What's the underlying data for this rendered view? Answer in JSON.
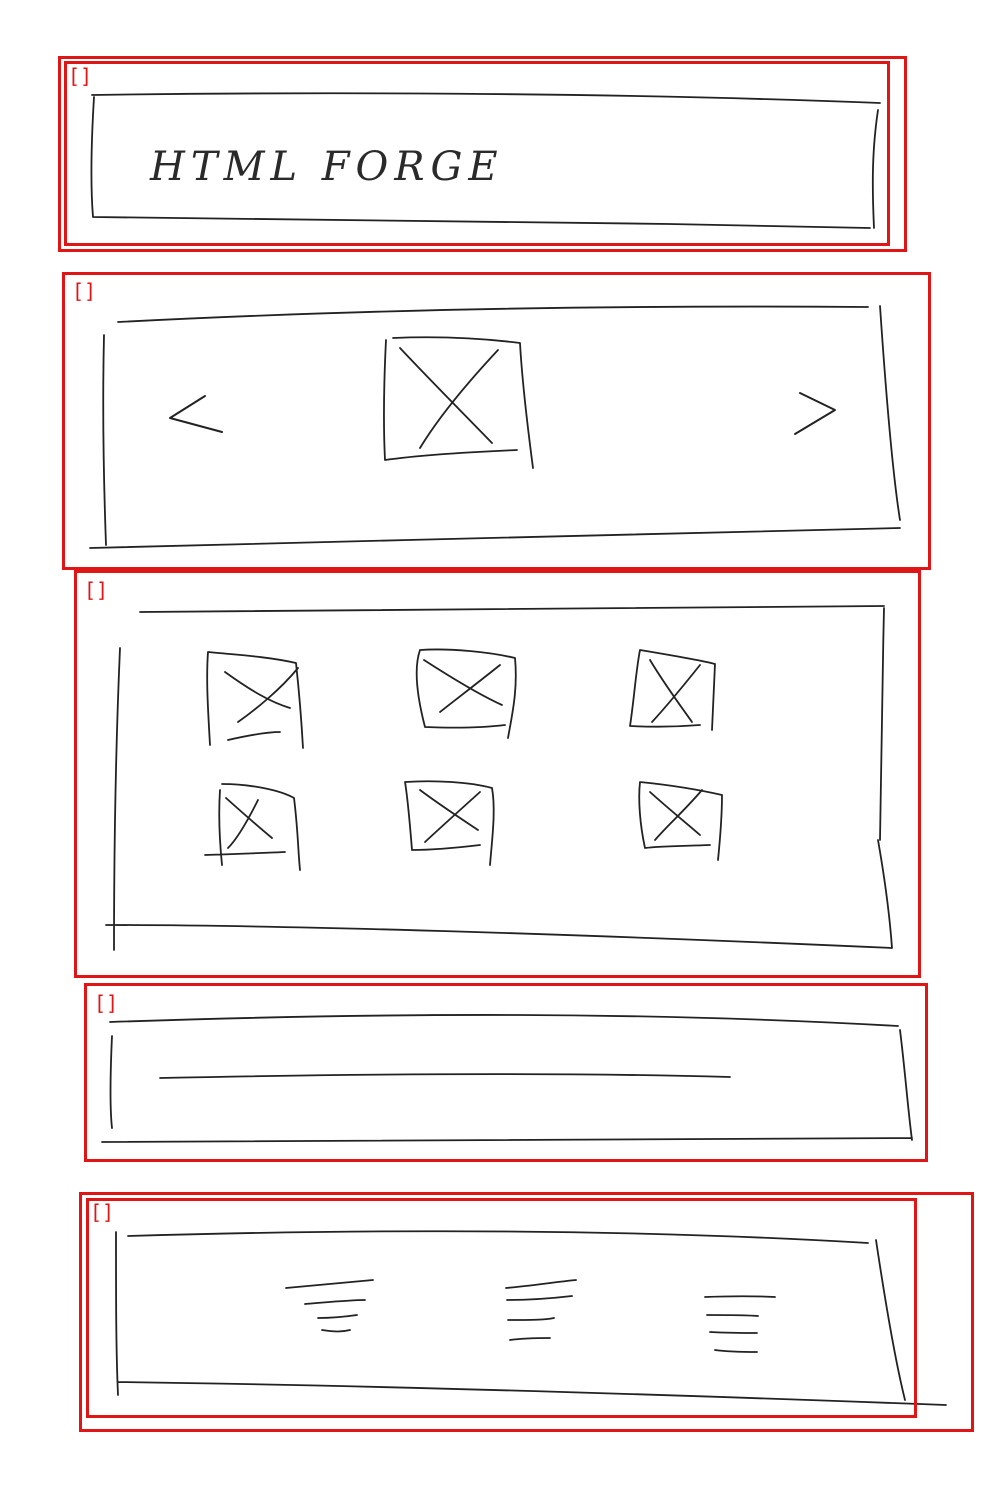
{
  "header": {
    "logo_text": "HTML FORGE"
  },
  "annotation": {
    "marker_glyph": "[]",
    "box_color": "#e01515",
    "ink_color": "#222222"
  },
  "carousel": {
    "prev_glyph": "<",
    "next_glyph": ">"
  }
}
